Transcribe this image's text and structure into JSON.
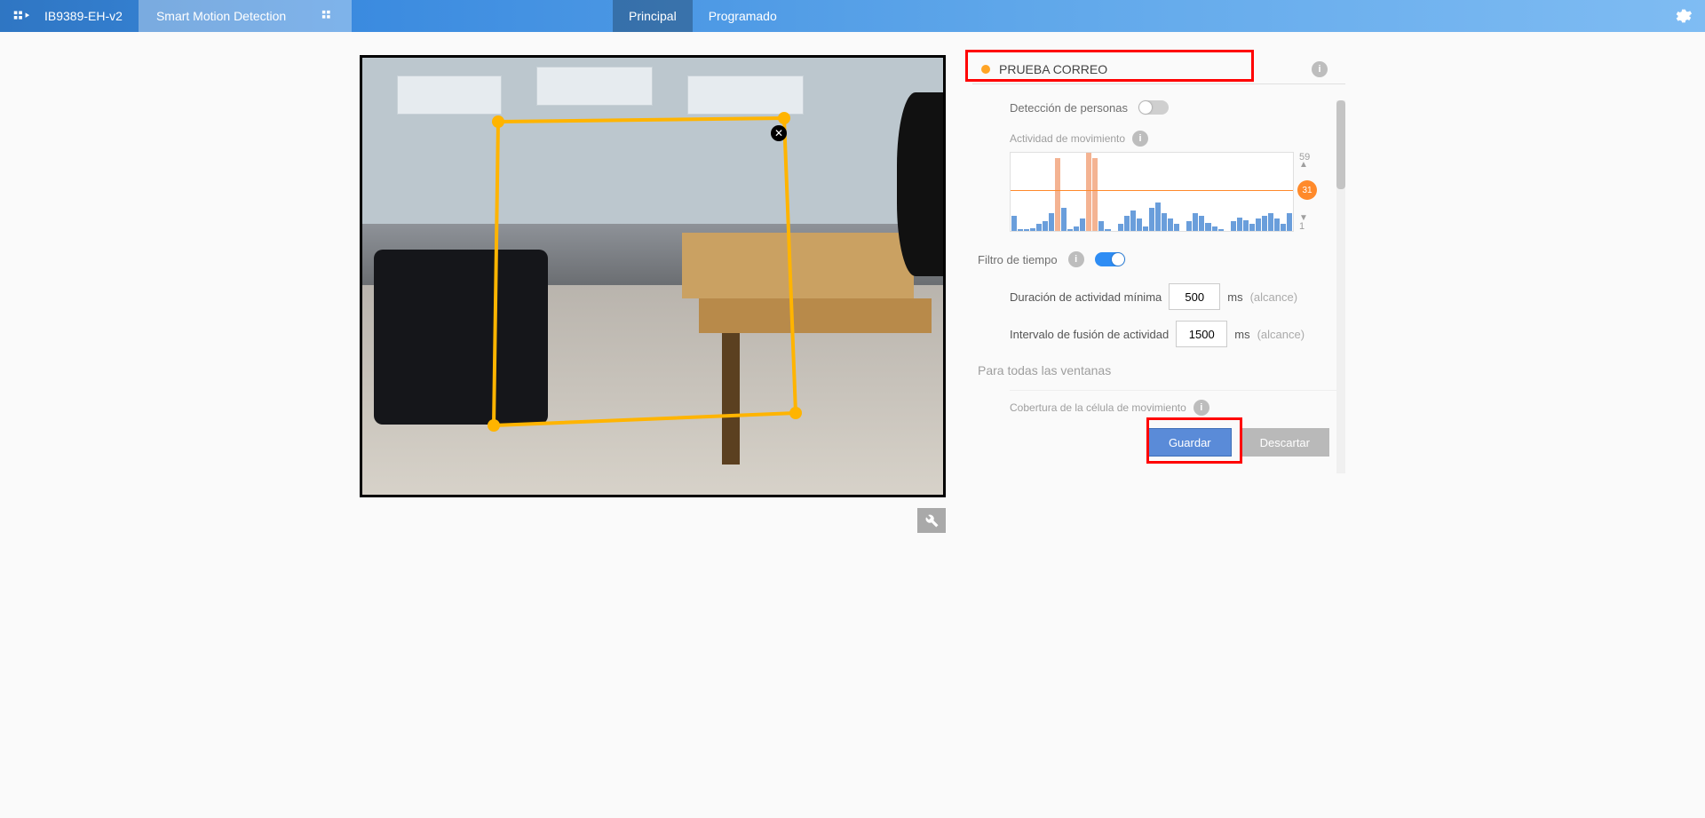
{
  "topbar": {
    "model": "IB9389-EH-v2",
    "feature": "Smart Motion Detection",
    "tabs": {
      "principal": "Principal",
      "programado": "Programado"
    }
  },
  "video": {
    "roi_close": "✕"
  },
  "panel": {
    "title": "PRUEBA CORREO",
    "person_detection_label": "Detección de personas",
    "motion_activity_label": "Actividad de movimiento",
    "time_filter_label": "Filtro de tiempo",
    "min_duration_label": "Duración de actividad mínima",
    "min_duration_value": "500",
    "merge_interval_label": "Intervalo de fusión de actividad",
    "merge_interval_value": "1500",
    "unit": "ms",
    "range_hint": "(alcance)",
    "all_windows": "Para todas las ventanas",
    "coverage_label": "Cobertura de la célula de movimiento"
  },
  "chart_data": {
    "type": "bar",
    "ymax": 59,
    "ymin": 1,
    "threshold": 31,
    "values": [
      12,
      2,
      2,
      3,
      6,
      8,
      14,
      55,
      18,
      2,
      4,
      10,
      59,
      55,
      8,
      2,
      1,
      6,
      12,
      16,
      10,
      4,
      18,
      22,
      14,
      10,
      6,
      1,
      8,
      14,
      12,
      7,
      4,
      2,
      1,
      8,
      11,
      9,
      6,
      10,
      12,
      14,
      10,
      6,
      14
    ],
    "event_flags": [
      0,
      0,
      0,
      0,
      0,
      0,
      0,
      1,
      0,
      0,
      0,
      0,
      1,
      1,
      0,
      0,
      0,
      0,
      0,
      0,
      0,
      0,
      0,
      0,
      0,
      0,
      0,
      0,
      0,
      0,
      0,
      0,
      0,
      0,
      0,
      0,
      0,
      0,
      0,
      0,
      0,
      0,
      0,
      0,
      0
    ]
  },
  "actions": {
    "save": "Guardar",
    "discard": "Descartar"
  }
}
